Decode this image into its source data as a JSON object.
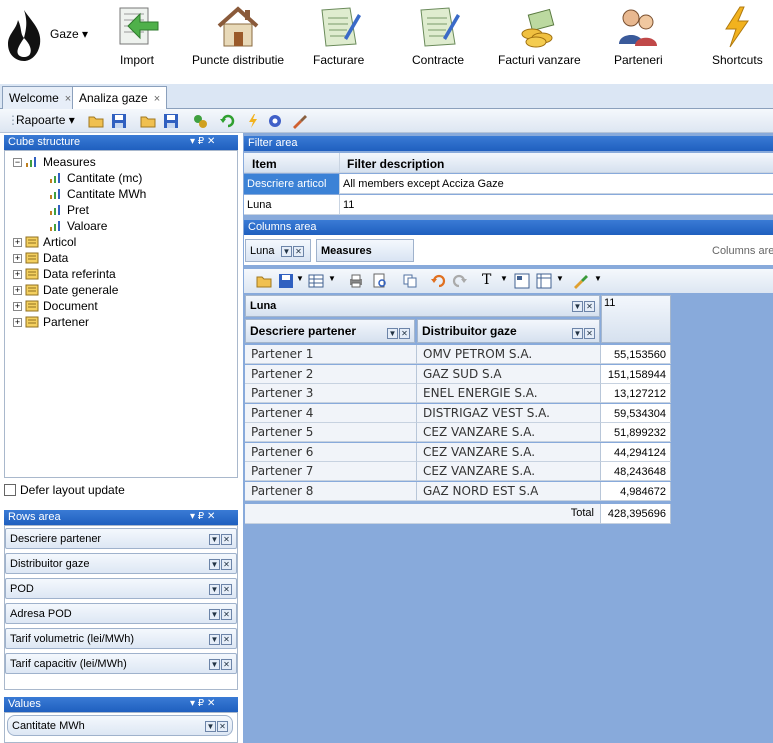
{
  "ribbon": {
    "app_menu": "Gaze ▾",
    "buttons": [
      {
        "label": "Import",
        "icon": "import-icon"
      },
      {
        "label": "Puncte distributie",
        "icon": "house-icon"
      },
      {
        "label": "Facturare",
        "icon": "invoice-icon"
      },
      {
        "label": "Contracte",
        "icon": "contract-icon"
      },
      {
        "label": "Facturi vanzare",
        "icon": "coins-icon"
      },
      {
        "label": "Parteneri",
        "icon": "partners-icon"
      },
      {
        "label": "Shortcuts",
        "icon": "lightning-icon"
      }
    ]
  },
  "tabs": [
    {
      "label": "Welcome",
      "close": "×"
    },
    {
      "label": "Analiza gaze",
      "close": "×"
    }
  ],
  "toolbar": {
    "rapoarte": "Rapoarte ▾"
  },
  "cube_structure": {
    "title": "Cube structure",
    "controls": "▾ ₽ ✕",
    "measures_label": "Measures",
    "measures": [
      "Cantitate (mc)",
      "Cantitate MWh",
      "Pret",
      "Valoare"
    ],
    "dimensions": [
      "Articol",
      "Data",
      "Data referinta",
      "Date generale",
      "Document",
      "Partener"
    ]
  },
  "defer_label": "Defer layout update",
  "rows_area": {
    "title": "Rows area",
    "controls": "▾ ₽ ✕",
    "fields": [
      "Descriere partener",
      "Distribuitor gaze",
      "POD",
      "Adresa POD",
      "Tarif volumetric (lei/MWh)",
      "Tarif capacitiv (lei/MWh)"
    ]
  },
  "values_area": {
    "title": "Values",
    "controls": "▾ ₽ ✕",
    "fields": [
      "Cantitate MWh"
    ]
  },
  "filter_area": {
    "title": "Filter area",
    "header": {
      "item": "Item",
      "description": "Filter description"
    },
    "rows": [
      {
        "item": "Descriere articol",
        "description": "All members except Acciza Gaze",
        "selected": true
      },
      {
        "item": "Luna",
        "description": "11",
        "selected": false
      }
    ]
  },
  "columns_area": {
    "title": "Columns area",
    "chips": [
      "Luna",
      "Measures"
    ],
    "placeholder": "Columns are"
  },
  "pivot": {
    "column_field": "Luna",
    "column_value": "11",
    "row_headers": [
      "Descriere partener",
      "Distribuitor gaze"
    ],
    "rows": [
      {
        "partener": "Partener 1",
        "distribuitor": "OMV PETROM S.A.",
        "value": "55,153560"
      },
      {
        "partener": "Partener 2",
        "distribuitor": "GAZ SUD S.A",
        "value": "151,158944"
      },
      {
        "partener": "Partener 3",
        "distribuitor": "ENEL ENERGIE S.A.",
        "value": "13,127212"
      },
      {
        "partener": "Partener 4",
        "distribuitor": "DISTRIGAZ VEST S.A.",
        "value": "59,534304"
      },
      {
        "partener": "Partener 5",
        "distribuitor": "CEZ VANZARE S.A.",
        "value": "51,899232"
      },
      {
        "partener": "Partener 6",
        "distribuitor": "CEZ VANZARE S.A.",
        "value": "44,294124"
      },
      {
        "partener": "Partener 7",
        "distribuitor": "CEZ VANZARE S.A.",
        "value": "48,243648"
      },
      {
        "partener": "Partener 8",
        "distribuitor": "GAZ NORD EST S.A",
        "value": "4,984672"
      }
    ],
    "total_label": "Total",
    "total_value": "428,395696"
  },
  "colors": {
    "panel_blue": "#2a6ccb",
    "workspace": "#88aadb",
    "selected_row": "#3c82d6"
  }
}
